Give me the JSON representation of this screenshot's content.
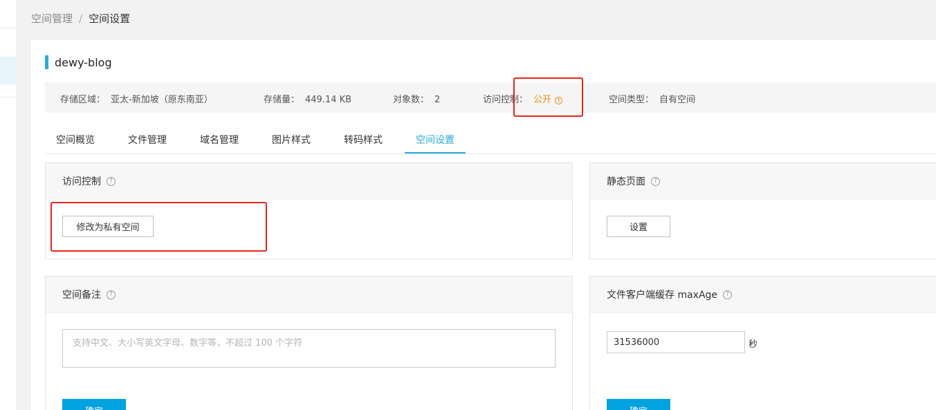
{
  "breadcrumb": {
    "parent": "空间管理",
    "separator": "/",
    "current": "空间设置"
  },
  "bucket": {
    "name": "dewy-blog"
  },
  "info": {
    "region_label": "存储区域：",
    "region_value": "亚太-新加坡（原东南亚）",
    "storage_label": "存储量：",
    "storage_value": "449.14 KB",
    "objects_label": "对象数：",
    "objects_value": "2",
    "access_label": "访问控制：",
    "access_value": "公开",
    "type_label": "空间类型：",
    "type_value": "自有空间"
  },
  "tabs": [
    {
      "label": "空间概览"
    },
    {
      "label": "文件管理"
    },
    {
      "label": "域名管理"
    },
    {
      "label": "图片样式"
    },
    {
      "label": "转码样式"
    },
    {
      "label": "空间设置"
    }
  ],
  "active_tab": "空间设置",
  "access_panel": {
    "title": "访问控制",
    "button": "修改为私有空间"
  },
  "static_panel": {
    "title": "静态页面",
    "button": "设置"
  },
  "remark_panel": {
    "title": "空间备注",
    "placeholder": "支持中文、大小写英文字母、数字等，不超过 100 个字符",
    "confirm": "确定"
  },
  "cache_panel": {
    "title": "文件客户端缓存 maxAge",
    "value": "31536000",
    "unit": "秒",
    "confirm": "确定"
  },
  "colors": {
    "accent": "#29abe2",
    "primary_button": "#00a2e0",
    "public_status": "#f08c1a",
    "highlight_box": "#e8231a"
  },
  "icons": {
    "help": "question-circle-icon",
    "warning": "exclamation-circle-icon"
  }
}
